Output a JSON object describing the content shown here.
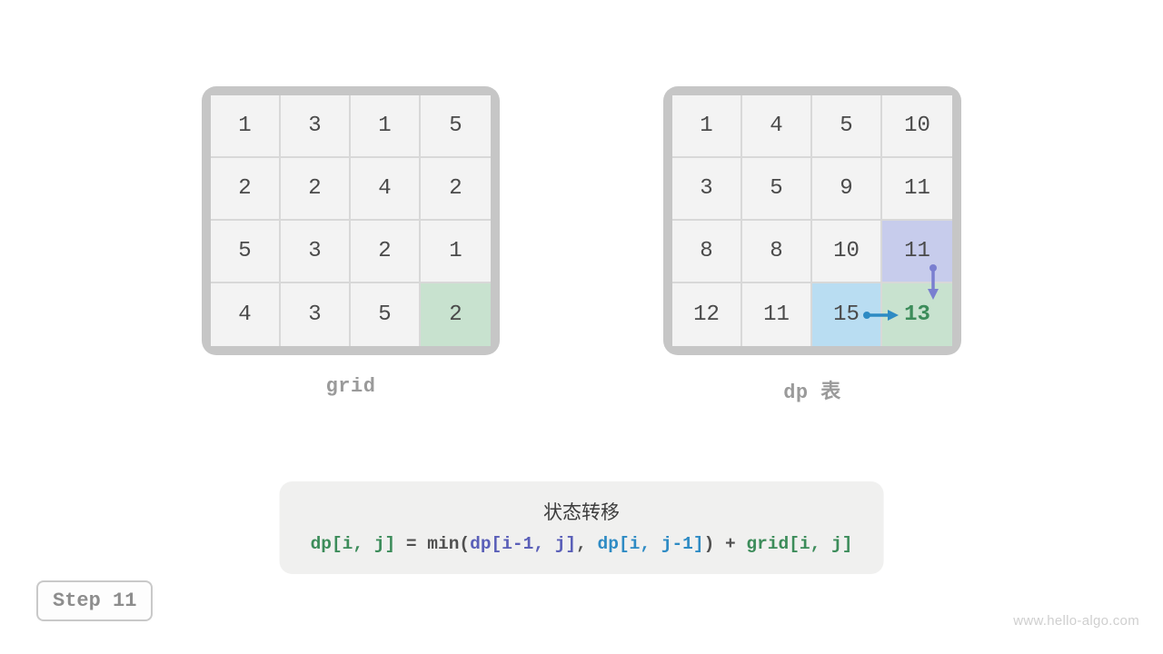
{
  "grid": {
    "label": "grid",
    "cells": [
      [
        1,
        3,
        1,
        5
      ],
      [
        2,
        2,
        4,
        2
      ],
      [
        5,
        3,
        2,
        1
      ],
      [
        4,
        3,
        5,
        2
      ]
    ],
    "highlight": {
      "r": 3,
      "c": 3,
      "type": "green"
    }
  },
  "dp": {
    "label": "dp 表",
    "cells": [
      [
        1,
        4,
        5,
        10
      ],
      [
        3,
        5,
        9,
        11
      ],
      [
        8,
        8,
        10,
        11
      ],
      [
        12,
        11,
        15,
        13
      ]
    ],
    "highlights": [
      {
        "r": 2,
        "c": 3,
        "type": "purple"
      },
      {
        "r": 3,
        "c": 2,
        "type": "blue"
      },
      {
        "r": 3,
        "c": 3,
        "type": "green",
        "boldGreen": true
      }
    ]
  },
  "formula": {
    "title": "状态转移",
    "lhs": "dp[i, j]",
    "eq": " = min(",
    "arg1": "dp[i-1, j]",
    "sep1": ", ",
    "arg2": "dp[i, j-1]",
    "close": ") + ",
    "rhs": "grid[i, j]"
  },
  "step": "Step 11",
  "watermark": "www.hello-algo.com",
  "colors": {
    "green": "#c8e2cf",
    "blue": "#b9ddf2",
    "purple": "#c7ccec",
    "arrowBlue": "#2e8bc4",
    "arrowPurple": "#7a7fd0"
  }
}
